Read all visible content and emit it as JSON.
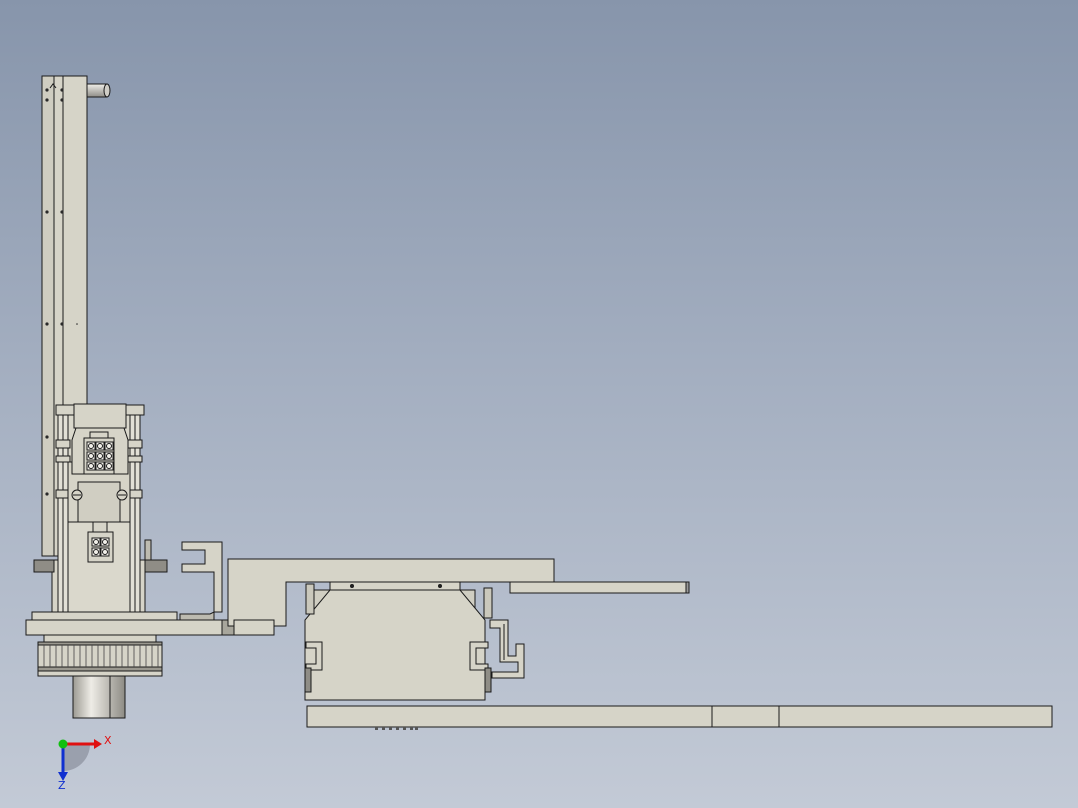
{
  "viewport": {
    "background_top": "#8795ab",
    "background_bottom": "#c3cad6",
    "part_fill": "#d6d4c8",
    "part_shade": "#c4c2b6",
    "edge_color": "#1a1a1a"
  },
  "triad": {
    "x_label": "X",
    "z_label": "Z",
    "x_color": "#e01010",
    "y_color": "#10c010",
    "z_color": "#1030d0"
  }
}
